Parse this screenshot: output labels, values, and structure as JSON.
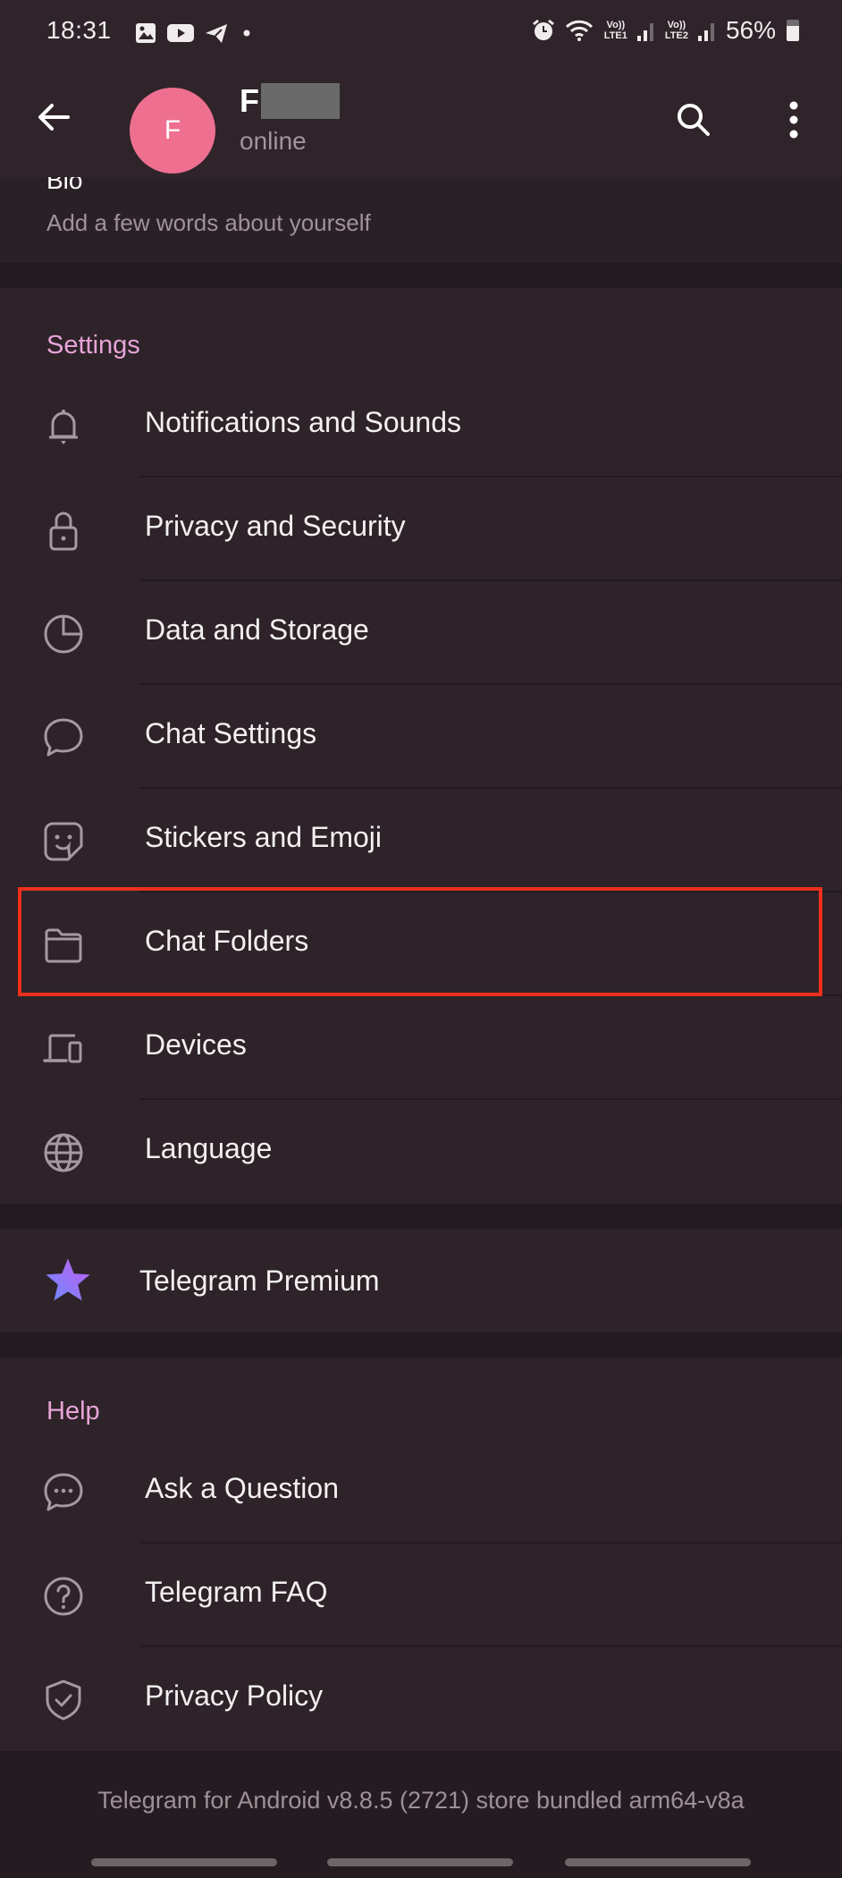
{
  "status_bar": {
    "time": "18:31",
    "notification_icons": [
      "gallery-icon",
      "youtube-icon",
      "telegram-icon",
      "dot-icon"
    ],
    "system_icons": [
      "alarm-icon",
      "wifi-icon",
      "lte1-signal-icon",
      "lte2-signal-icon"
    ],
    "sim1_label_top": "Vo))",
    "sim1_label_bottom": "LTE1",
    "sim2_label_top": "Vo))",
    "sim2_label_bottom": "LTE2",
    "battery_percent": "56%"
  },
  "header": {
    "avatar_initial": "F",
    "name_visible": "F",
    "name_redacted": true,
    "status": "online",
    "avatar_color": "#ee6f8f"
  },
  "bio": {
    "label": "Bio",
    "placeholder": "Add a few words about yourself"
  },
  "settings": {
    "title": "Settings",
    "items": [
      {
        "label": "Notifications and Sounds",
        "icon": "bell-icon"
      },
      {
        "label": "Privacy and Security",
        "icon": "lock-icon"
      },
      {
        "label": "Data and Storage",
        "icon": "pie-chart-icon"
      },
      {
        "label": "Chat Settings",
        "icon": "chat-bubble-icon"
      },
      {
        "label": "Stickers and Emoji",
        "icon": "sticker-icon"
      },
      {
        "label": "Chat Folders",
        "icon": "folder-icon",
        "highlighted": true
      },
      {
        "label": "Devices",
        "icon": "devices-icon"
      },
      {
        "label": "Language",
        "icon": "globe-icon"
      }
    ]
  },
  "premium": {
    "label": "Telegram Premium",
    "icon": "premium-star-icon"
  },
  "help": {
    "title": "Help",
    "items": [
      {
        "label": "Ask a Question",
        "icon": "chat-dots-icon"
      },
      {
        "label": "Telegram FAQ",
        "icon": "question-circle-icon"
      },
      {
        "label": "Privacy Policy",
        "icon": "shield-check-icon"
      }
    ]
  },
  "footer": {
    "version": "Telegram for Android v8.8.5 (2721) store bundled arm64-v8a"
  },
  "colors": {
    "accent": "#e8a4d8",
    "highlight_box": "#f0301c",
    "background": "#2d2329",
    "header_bg": "#30242b"
  }
}
